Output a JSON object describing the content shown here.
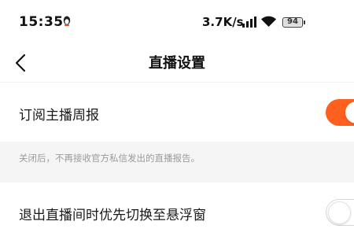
{
  "status_bar": {
    "time": "15:35",
    "net_speed": "3.7K/s",
    "battery": "94",
    "icons": [
      "notification-icon",
      "signal-icon",
      "wifi-icon",
      "battery-icon"
    ]
  },
  "nav": {
    "title": "直播设置",
    "back_icon": "chevron-left-icon"
  },
  "settings": [
    {
      "label": "订阅主播周报",
      "enabled": true
    },
    {
      "label": "退出直播间时优先切换至悬浮窗",
      "enabled": false
    }
  ],
  "hint": "关闭后，不再接收官方私信发出的直播报告。",
  "colors": {
    "accent": "#ff5f1f",
    "hint_bg": "#f5f5f5",
    "hint_text": "#9a9a9a"
  }
}
